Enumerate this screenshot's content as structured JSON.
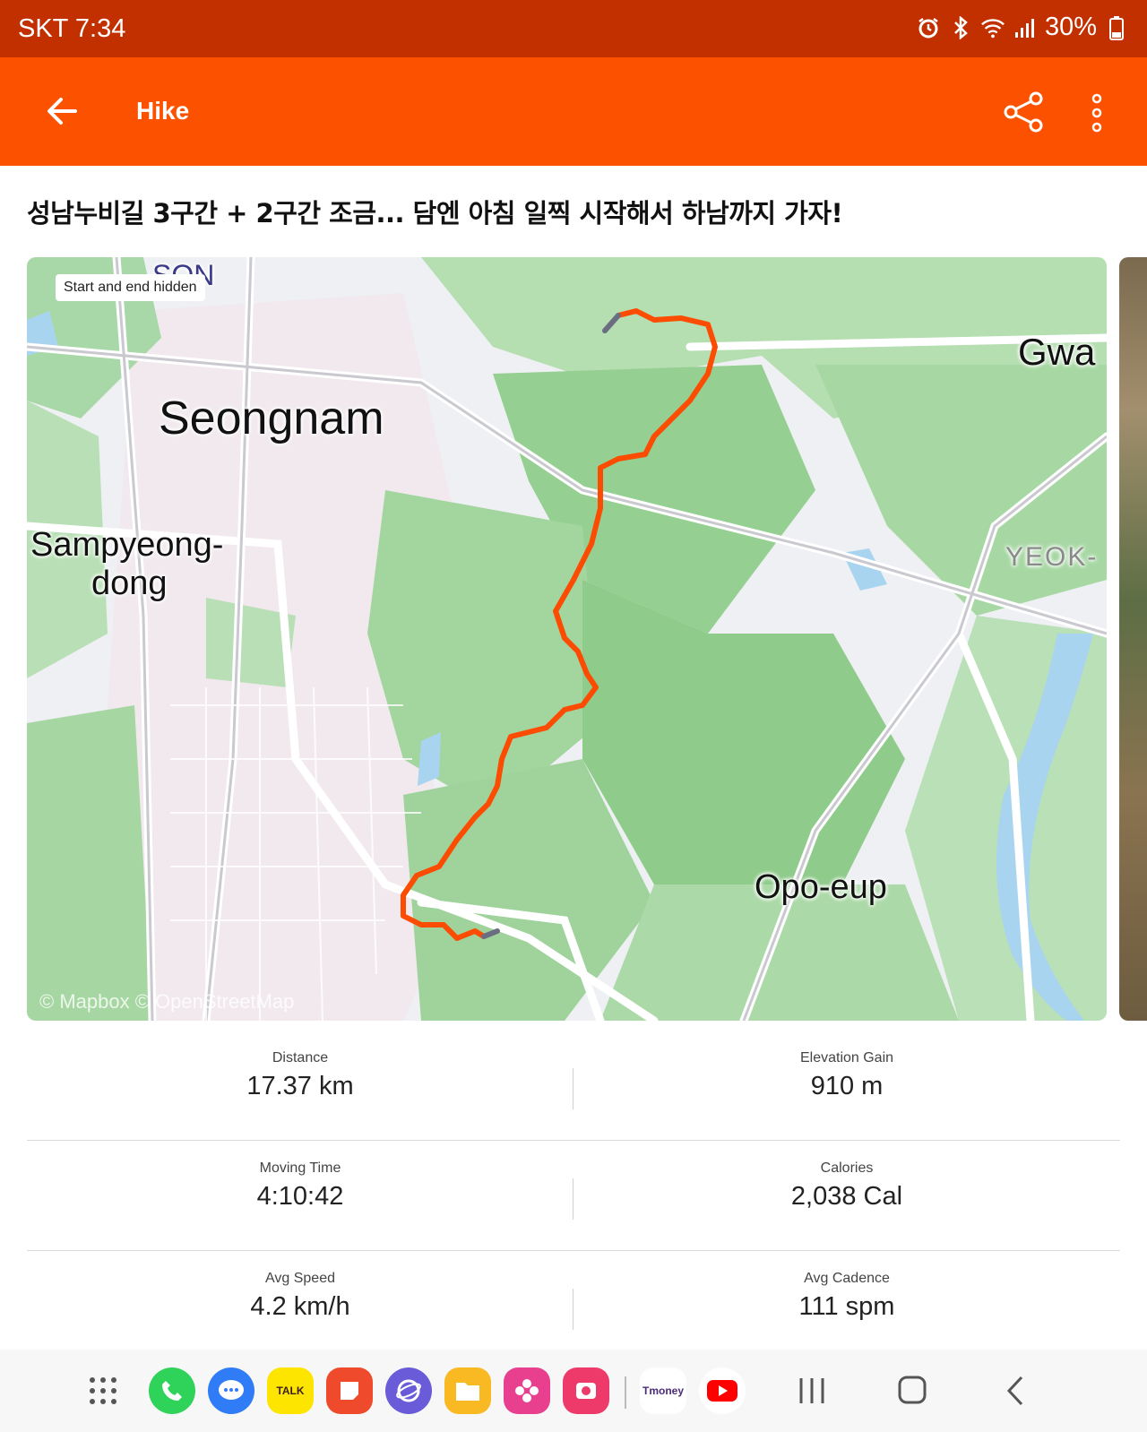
{
  "status_bar": {
    "carrier_time": "SKT 7:34",
    "battery": "30%",
    "icons": [
      "alarm-icon",
      "bluetooth-icon",
      "wifi-icon",
      "signal-icon",
      "battery-icon"
    ]
  },
  "app_bar": {
    "title": "Hike",
    "back_icon": "back-arrow-icon",
    "share_icon": "share-icon",
    "more_icon": "more-vertical-icon",
    "color": "#fc5200"
  },
  "activity": {
    "title": "성남누비길 3구간 + 2구간 조금... 담엔 아침 일찍 시작해서 하남까지 가자!"
  },
  "map": {
    "badge": "Start and end hidden",
    "labels": {
      "seongnam": "Seongnam",
      "sampyeong1": "Sampyeong-",
      "sampyeong2": "dong",
      "gwa": "Gwa",
      "yeok": "YEOK-",
      "opo": "Opo-eup",
      "top_partial": "SON"
    },
    "attribution": "© Mapbox © OpenStreetMap",
    "route_color": "#fc4c02"
  },
  "stats": {
    "distance": {
      "label": "Distance",
      "value": "17.37 km"
    },
    "elevation": {
      "label": "Elevation Gain",
      "value": "910 m"
    },
    "moving_time": {
      "label": "Moving Time",
      "value": "4:10:42"
    },
    "calories": {
      "label": "Calories",
      "value": "2,038 Cal"
    },
    "avg_speed": {
      "label": "Avg Speed",
      "value": "4.2 km/h"
    },
    "avg_cadence": {
      "label": "Avg Cadence",
      "value": "111 spm"
    }
  },
  "nav_bar": {
    "apps": [
      {
        "name": "app-drawer-icon"
      },
      {
        "name": "phone-app-icon",
        "color": "#2fd35a"
      },
      {
        "name": "messages-app-icon",
        "color": "#2f7cf6"
      },
      {
        "name": "kakaotalk-app-icon",
        "color": "#fee500",
        "label": "TALK"
      },
      {
        "name": "notes-app-icon",
        "color": "#f04a2d"
      },
      {
        "name": "internet-app-icon",
        "color": "#6a5bd9"
      },
      {
        "name": "my-files-app-icon",
        "color": "#f8b923"
      },
      {
        "name": "bixby-app-icon",
        "color": "#e83f8f"
      },
      {
        "name": "camera-app-icon",
        "color": "#ee3a6a"
      },
      {
        "name": "tmoney-app-icon",
        "label": "Tmoney"
      },
      {
        "name": "youtube-app-icon",
        "color": "#ff0000"
      }
    ],
    "system": [
      "recents-button",
      "home-button",
      "back-button"
    ]
  }
}
